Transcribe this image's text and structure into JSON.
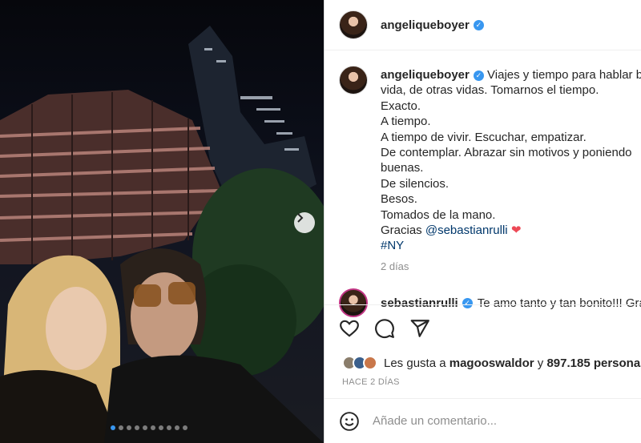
{
  "post": {
    "username": "angeliqueboyer",
    "caption_lines": [
      "Viajes y tiempo para hablar b",
      "vida, de otras vidas. Tomarnos el tiempo.",
      "Exacto.",
      "A tiempo.",
      "A tiempo de vivir. Escuchar, empatizar.",
      "De contemplar. Abrazar sin motivos y poniendo",
      "buenas.",
      "De silencios.",
      "Besos.",
      "Tomados de la mano."
    ],
    "thanks_prefix": "Gracias",
    "mention": "@sebastianrulli",
    "heart_emoji": "❤",
    "hashtag": "#NY",
    "age": "2 días"
  },
  "comment_peek": {
    "username": "sebastianrulli",
    "text": "Te amo tanto y tan bonito!!! Gra"
  },
  "likes": {
    "prefix": "Les gusta a",
    "user": "magooswaldor",
    "connector": "y",
    "count": "897.185 personas"
  },
  "timestamp": "HACE 2 DÍAS",
  "comment_input": {
    "placeholder": "Añade un comentario..."
  },
  "carousel": {
    "total": 10,
    "active_index": 0
  },
  "icons": {
    "verified": "verified-badge-icon",
    "like": "heart-outline-icon",
    "comment": "comment-bubble-icon",
    "share": "paper-plane-icon",
    "emoji": "emoji-smile-icon",
    "next": "chevron-right-icon"
  },
  "colors": {
    "verified": "#3897f0",
    "link": "#00376b",
    "heart": "#ed4956",
    "muted": "#8e8e8e"
  }
}
